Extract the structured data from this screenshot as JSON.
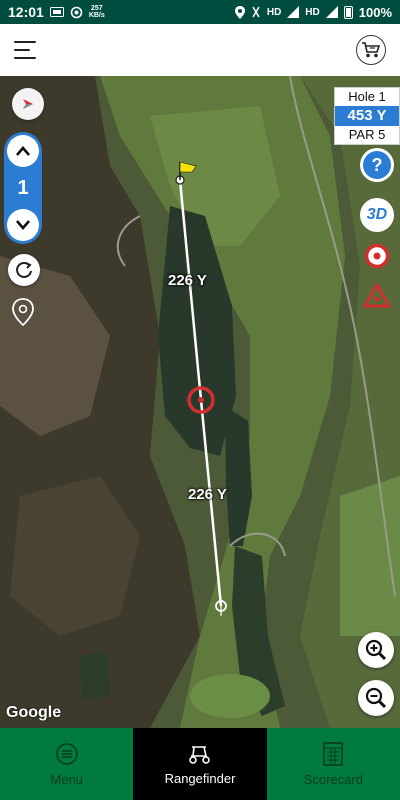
{
  "status_bar": {
    "time": "12:01",
    "speed_value": "257",
    "speed_unit": "KB/s",
    "hd1": "HD",
    "hd2": "HD",
    "battery": "100%"
  },
  "header": {
    "menu_icon": "hamburger-menu-icon",
    "cart_icon": "golf-cart-shop-icon"
  },
  "map": {
    "distance_to_pin": "226 Y",
    "distance_from_tee": "226 Y",
    "attribution": "Google",
    "flag_color": "#f5e10a",
    "target_color": "#d32f2f"
  },
  "hole_selector": {
    "hole_number": "1"
  },
  "hole_info": {
    "hole": "Hole 1",
    "yards": "453 Y",
    "par": "PAR 5"
  },
  "right_controls": {
    "help_label": "?",
    "three_d_label": "3D"
  },
  "bottom_nav": {
    "items": [
      {
        "label": "Menu",
        "icon": "menu-circle-icon"
      },
      {
        "label": "Rangefinder",
        "icon": "golf-cart-icon"
      },
      {
        "label": "Scorecard",
        "icon": "scorecard-icon"
      }
    ],
    "active": "Rangefinder"
  },
  "colors": {
    "status_bar_bg": "#004d40",
    "accent_blue": "#2b7cd3",
    "nav_green": "#007a3d"
  }
}
